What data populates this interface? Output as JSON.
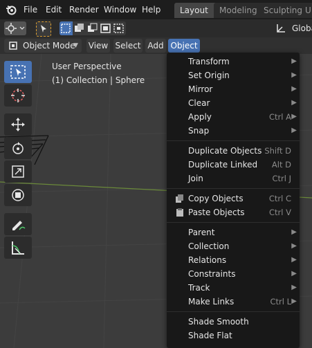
{
  "menubar": {
    "items": [
      "File",
      "Edit",
      "Render",
      "Window",
      "Help"
    ],
    "workspaces": [
      "Layout",
      "Modeling",
      "Sculpting",
      "U"
    ]
  },
  "toolheader": {
    "orientation_label": "Globa"
  },
  "viewport_header": {
    "mode": "Object Mode",
    "menus": [
      "View",
      "Select",
      "Add",
      "Object"
    ]
  },
  "viewport": {
    "perspective": "User Perspective",
    "collection": "(1) Collection | Sphere"
  },
  "object_menu": {
    "groups": [
      [
        {
          "label": "Transform",
          "shortcut": "",
          "submenu": true
        },
        {
          "label": "Set Origin",
          "shortcut": "",
          "submenu": true
        },
        {
          "label": "Mirror",
          "shortcut": "",
          "submenu": true
        },
        {
          "label": "Clear",
          "shortcut": "",
          "submenu": true
        },
        {
          "label": "Apply",
          "shortcut": "Ctrl A",
          "submenu": true
        },
        {
          "label": "Snap",
          "shortcut": "",
          "submenu": true
        }
      ],
      [
        {
          "label": "Duplicate Objects",
          "shortcut": "Shift D",
          "submenu": false
        },
        {
          "label": "Duplicate Linked",
          "shortcut": "Alt D",
          "submenu": false
        },
        {
          "label": "Join",
          "shortcut": "Ctrl J",
          "submenu": false
        }
      ],
      [
        {
          "label": "Copy Objects",
          "shortcut": "Ctrl C",
          "submenu": false,
          "icon": "copy-icon"
        },
        {
          "label": "Paste Objects",
          "shortcut": "Ctrl V",
          "submenu": false,
          "icon": "paste-icon"
        }
      ],
      [
        {
          "label": "Parent",
          "shortcut": "",
          "submenu": true
        },
        {
          "label": "Collection",
          "shortcut": "",
          "submenu": true
        },
        {
          "label": "Relations",
          "shortcut": "",
          "submenu": true
        },
        {
          "label": "Constraints",
          "shortcut": "",
          "submenu": true
        },
        {
          "label": "Track",
          "shortcut": "",
          "submenu": true
        },
        {
          "label": "Make Links",
          "shortcut": "Ctrl L",
          "submenu": true
        }
      ],
      [
        {
          "label": "Shade Smooth",
          "shortcut": "",
          "submenu": false
        },
        {
          "label": "Shade Flat",
          "shortcut": "",
          "submenu": false
        }
      ]
    ]
  },
  "colors": {
    "accent": "#4772b3",
    "menu_bg": "#181818",
    "viewport_bg": "#3c3c3c"
  }
}
